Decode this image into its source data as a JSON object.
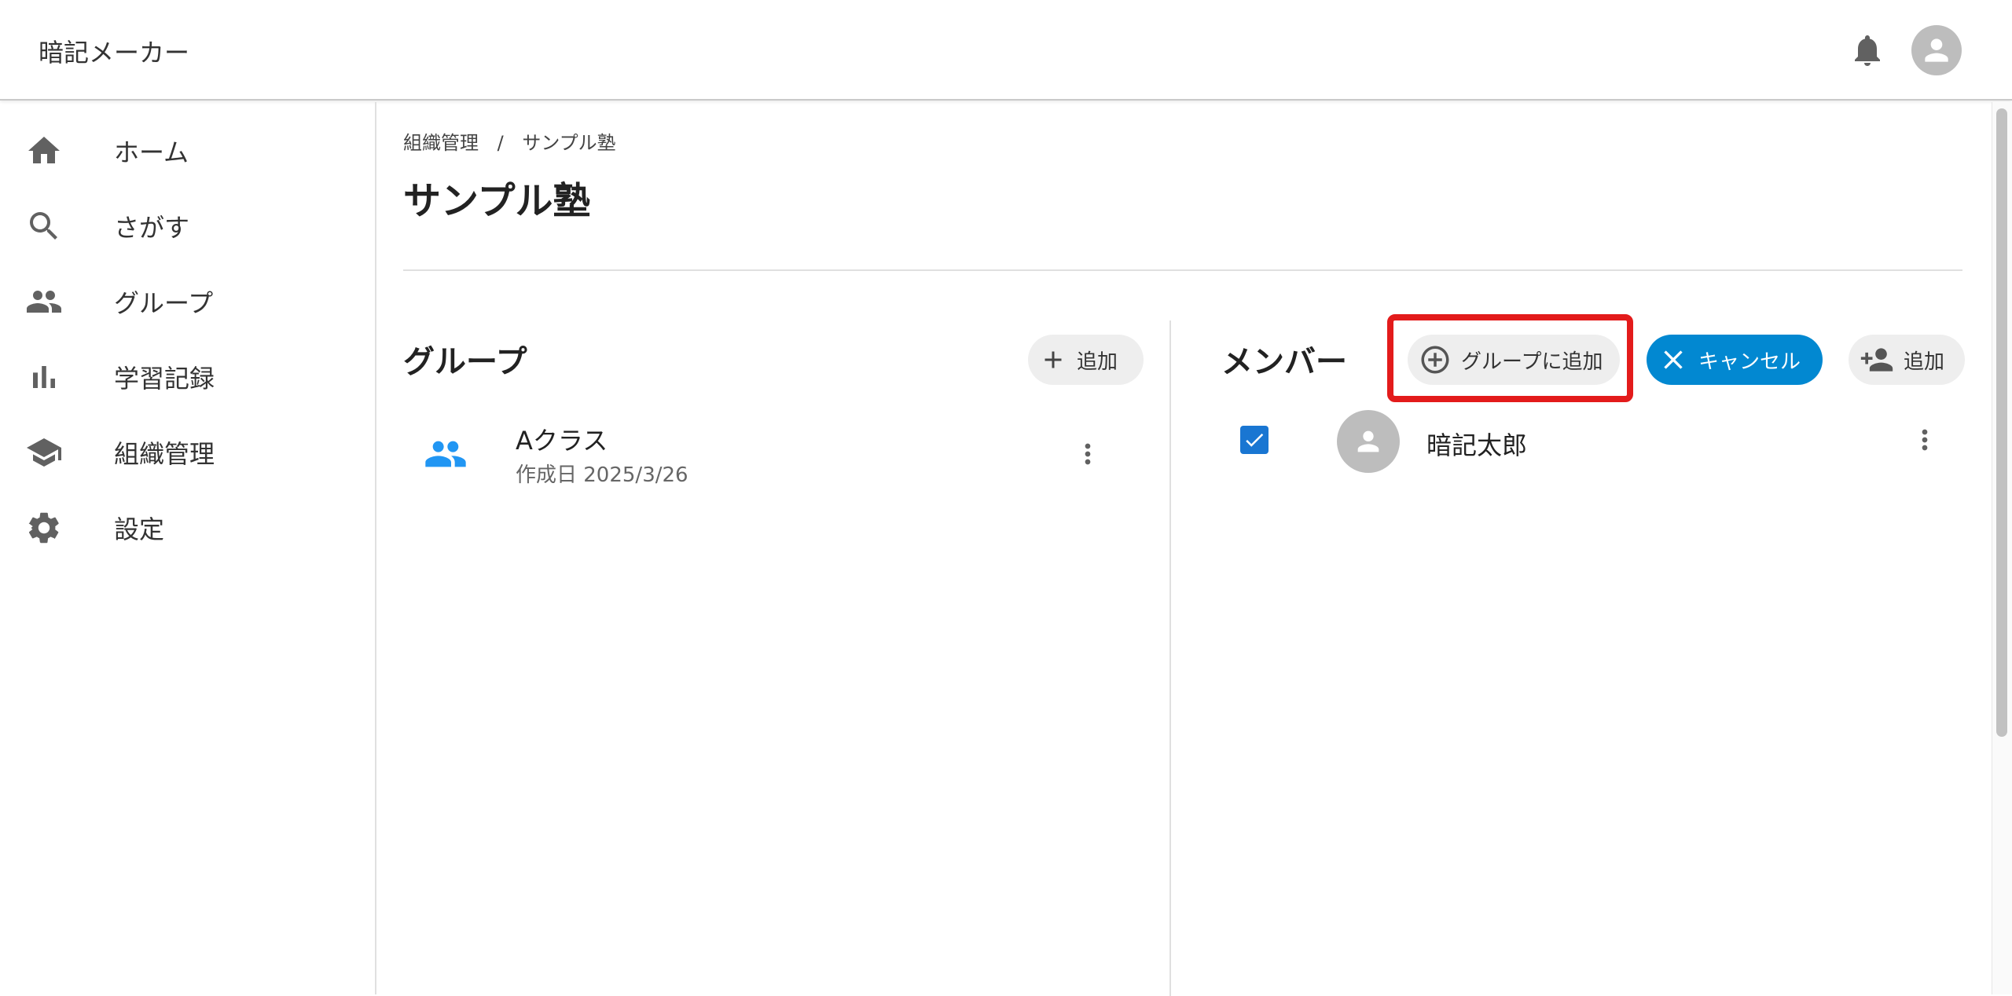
{
  "app": {
    "title": "暗記メーカー"
  },
  "sidebar": {
    "items": [
      {
        "label": "ホーム",
        "icon": "home-icon"
      },
      {
        "label": "さがす",
        "icon": "search-icon"
      },
      {
        "label": "グループ",
        "icon": "people-icon"
      },
      {
        "label": "学習記録",
        "icon": "bar-chart-icon"
      },
      {
        "label": "組織管理",
        "icon": "school-icon"
      },
      {
        "label": "設定",
        "icon": "gear-icon"
      }
    ]
  },
  "breadcrumb": {
    "items": [
      "組織管理",
      "/",
      "サンプル塾"
    ]
  },
  "page": {
    "title": "サンプル塾"
  },
  "groups": {
    "title": "グループ",
    "add_label": "追加",
    "list": [
      {
        "name": "Aクラス",
        "date": "作成日 2025/3/26"
      }
    ]
  },
  "members": {
    "title": "メンバー",
    "add_to_group_label": "グループに追加",
    "cancel_label": "キャンセル",
    "add_label": "追加",
    "list": [
      {
        "name": "暗記太郎",
        "checked": true
      }
    ]
  },
  "colors": {
    "accent_blue": "#0288d1",
    "group_icon_blue": "#2196f3",
    "checkbox_blue": "#1976d2",
    "highlight_red": "#e31b1b",
    "icon_gray": "#616161"
  }
}
